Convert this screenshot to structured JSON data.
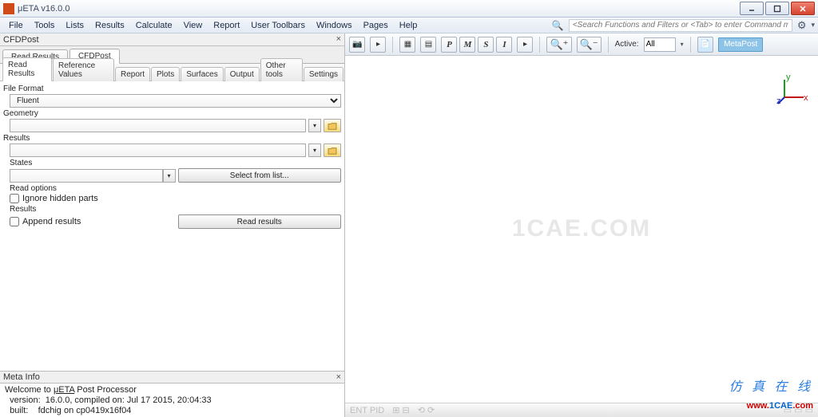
{
  "titlebar": {
    "title": "μETA v16.0.0"
  },
  "menu": [
    "File",
    "Tools",
    "Lists",
    "Results",
    "Calculate",
    "View",
    "Report",
    "User Toolbars",
    "Windows",
    "Pages",
    "Help"
  ],
  "search": {
    "placeholder": "<Search Functions and Filters or <Tab> to enter Command mode>"
  },
  "left_panel": {
    "header": "CFDPost",
    "top_tabs": [
      "Read Results",
      "CFDPost"
    ],
    "top_active": 1,
    "inner_tabs": [
      "Read Results",
      "Reference Values",
      "Report",
      "Plots",
      "Surfaces",
      "Output",
      "Other tools",
      "Settings"
    ],
    "inner_active": 0,
    "labels": {
      "file_format": "File Format",
      "fluent": "Fluent",
      "geometry": "Geometry",
      "results": "Results",
      "states": "States",
      "select_from_list": "Select from list...",
      "read_options": "Read options",
      "ignore_hidden": "Ignore hidden parts",
      "results2": "Results",
      "append_results": "Append results",
      "read_results_btn": "Read results"
    }
  },
  "meta": {
    "header": "Meta Info",
    "line1_a": "Welcome to ",
    "line1_b": "μETA",
    "line1_c": " Post Processor",
    "line2": "  version:  16.0.0, compiled on: Jul 17 2015, 20:04:33",
    "line3": "  built:    fdchig on cp0419x16f04"
  },
  "right_toolbar": {
    "letters": [
      "P",
      "M",
      "S",
      "I"
    ],
    "active_label": "Active:",
    "active_value": "All",
    "badge": "MetaPost"
  },
  "viewport": {
    "watermark": "1CAE.COM",
    "axis": {
      "x": "x",
      "y": "y",
      "z": "z"
    }
  },
  "overlay": {
    "cn": "仿 真 在 线",
    "url_w": "www.",
    "url_d": "1CAE",
    "url_e": ".com"
  }
}
